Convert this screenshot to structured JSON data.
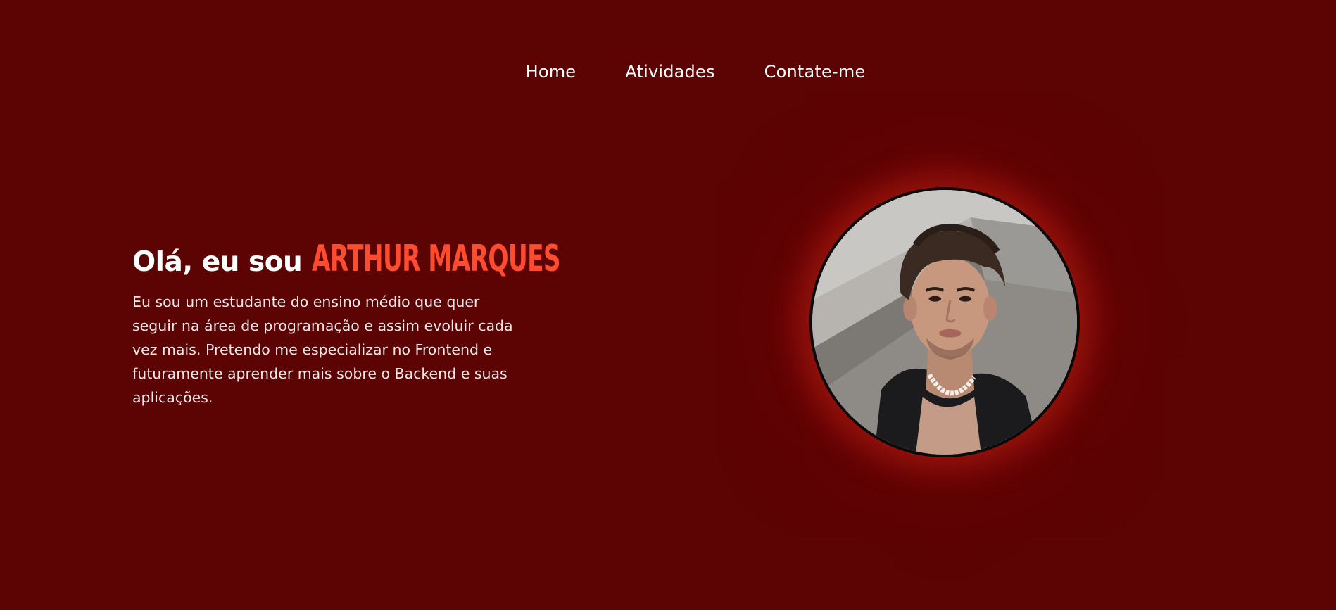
{
  "nav": {
    "items": [
      {
        "label": "Home"
      },
      {
        "label": "Atividades"
      },
      {
        "label": "Contate-me"
      }
    ]
  },
  "hero": {
    "greeting": "Olá, eu sou",
    "name": "ARTHUR MARQUES",
    "bio": "Eu sou um estudante do ensino médio que quer seguir na área de programação e assim evoluir cada vez mais. Pretendo me especializar no Frontend e futuramente aprender mais sobre o Backend e suas aplicações."
  },
  "colors": {
    "background": "#5c0304",
    "accent": "#ff4b2e",
    "text": "#ffffff"
  }
}
